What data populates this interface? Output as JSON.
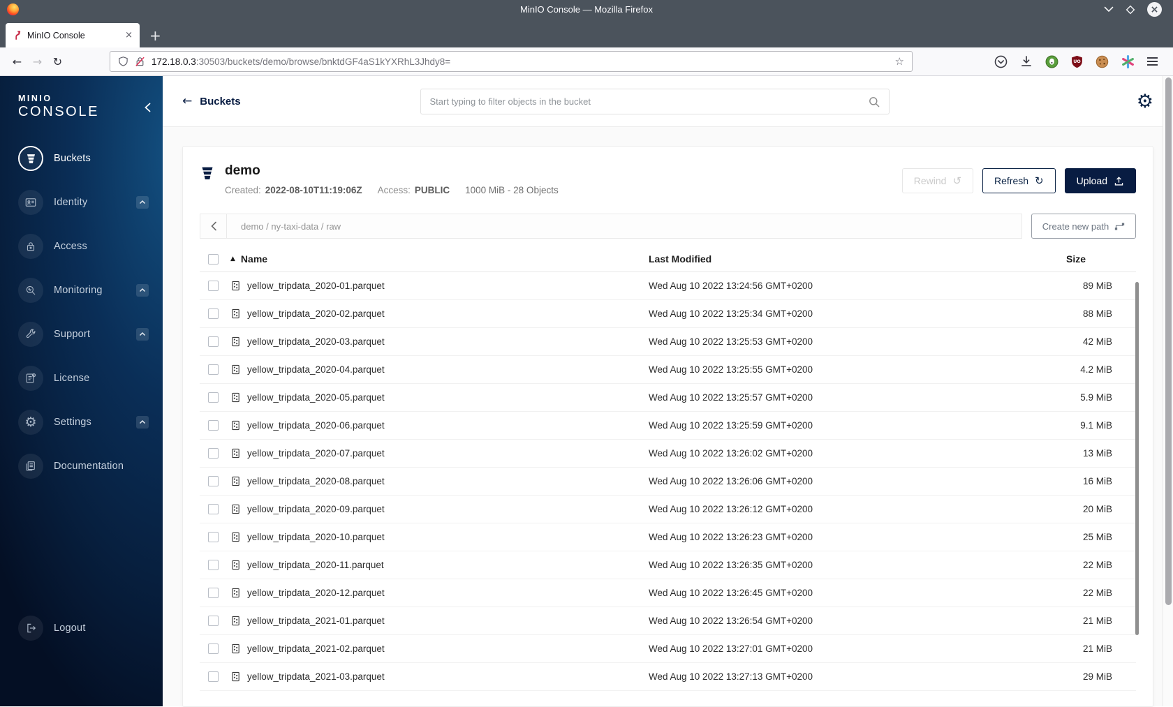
{
  "window": {
    "title": "MinIO Console — Mozilla Firefox"
  },
  "browser": {
    "tab_title": "MinIO Console",
    "url_host": "172.18.0.3",
    "url_path": ":30503/buckets/demo/browse/bnktdGF4aS1kYXRhL3Jhdy8=",
    "extension_icons": [
      "pocket-icon",
      "download-icon",
      "privacy-badger-icon",
      "ublock-origin-icon",
      "cookie-icon",
      "asterisk-extension-icon",
      "menu-icon"
    ]
  },
  "glyphs": {
    "back_arrow": "←",
    "forward_arrow": "→",
    "reload": "↻",
    "refresh": "↻",
    "rewind": "↺",
    "gear": "⚙",
    "bookmark_star": "☆",
    "sort_asc": "▲",
    "new_tab": "+",
    "close": "×"
  },
  "sidebar": {
    "logo_line1": "MINIO",
    "logo_line2": "CONSOLE",
    "items": [
      {
        "label": "Buckets",
        "icon": "buckets-icon",
        "selected": true,
        "expandable": false
      },
      {
        "label": "Identity",
        "icon": "identity-icon",
        "selected": false,
        "expandable": true
      },
      {
        "label": "Access",
        "icon": "access-icon",
        "selected": false,
        "expandable": false
      },
      {
        "label": "Monitoring",
        "icon": "monitoring-icon",
        "selected": false,
        "expandable": true
      },
      {
        "label": "Support",
        "icon": "support-icon",
        "selected": false,
        "expandable": true
      },
      {
        "label": "License",
        "icon": "license-icon",
        "selected": false,
        "expandable": false
      },
      {
        "label": "Settings",
        "icon": "settings-icon",
        "selected": false,
        "expandable": true
      },
      {
        "label": "Documentation",
        "icon": "documentation-icon",
        "selected": false,
        "expandable": false
      }
    ],
    "logout": {
      "label": "Logout",
      "icon": "logout-icon"
    }
  },
  "header": {
    "back_label": "Buckets",
    "search_placeholder": "Start typing to filter objects in the bucket"
  },
  "bucket": {
    "name": "demo",
    "created_label": "Created:",
    "created_value": "2022-08-10T11:19:06Z",
    "access_label": "Access:",
    "access_value": "PUBLIC",
    "summary": "1000 MiB - 28 Objects",
    "buttons": {
      "rewind": "Rewind",
      "refresh": "Refresh",
      "upload": "Upload"
    }
  },
  "pathbar": {
    "breadcrumb": "demo / ny-taxi-data / raw",
    "create_button": "Create new path"
  },
  "table": {
    "columns": {
      "name": "Name",
      "modified": "Last Modified",
      "size": "Size"
    },
    "rows": [
      {
        "name": "yellow_tripdata_2020-01.parquet",
        "modified": "Wed Aug 10 2022 13:24:56 GMT+0200",
        "size": "89 MiB"
      },
      {
        "name": "yellow_tripdata_2020-02.parquet",
        "modified": "Wed Aug 10 2022 13:25:34 GMT+0200",
        "size": "88 MiB"
      },
      {
        "name": "yellow_tripdata_2020-03.parquet",
        "modified": "Wed Aug 10 2022 13:25:53 GMT+0200",
        "size": "42 MiB"
      },
      {
        "name": "yellow_tripdata_2020-04.parquet",
        "modified": "Wed Aug 10 2022 13:25:55 GMT+0200",
        "size": "4.2 MiB"
      },
      {
        "name": "yellow_tripdata_2020-05.parquet",
        "modified": "Wed Aug 10 2022 13:25:57 GMT+0200",
        "size": "5.9 MiB"
      },
      {
        "name": "yellow_tripdata_2020-06.parquet",
        "modified": "Wed Aug 10 2022 13:25:59 GMT+0200",
        "size": "9.1 MiB"
      },
      {
        "name": "yellow_tripdata_2020-07.parquet",
        "modified": "Wed Aug 10 2022 13:26:02 GMT+0200",
        "size": "13 MiB"
      },
      {
        "name": "yellow_tripdata_2020-08.parquet",
        "modified": "Wed Aug 10 2022 13:26:06 GMT+0200",
        "size": "16 MiB"
      },
      {
        "name": "yellow_tripdata_2020-09.parquet",
        "modified": "Wed Aug 10 2022 13:26:12 GMT+0200",
        "size": "20 MiB"
      },
      {
        "name": "yellow_tripdata_2020-10.parquet",
        "modified": "Wed Aug 10 2022 13:26:23 GMT+0200",
        "size": "25 MiB"
      },
      {
        "name": "yellow_tripdata_2020-11.parquet",
        "modified": "Wed Aug 10 2022 13:26:35 GMT+0200",
        "size": "22 MiB"
      },
      {
        "name": "yellow_tripdata_2020-12.parquet",
        "modified": "Wed Aug 10 2022 13:26:45 GMT+0200",
        "size": "22 MiB"
      },
      {
        "name": "yellow_tripdata_2021-01.parquet",
        "modified": "Wed Aug 10 2022 13:26:54 GMT+0200",
        "size": "21 MiB"
      },
      {
        "name": "yellow_tripdata_2021-02.parquet",
        "modified": "Wed Aug 10 2022 13:27:01 GMT+0200",
        "size": "21 MiB"
      },
      {
        "name": "yellow_tripdata_2021-03.parquet",
        "modified": "Wed Aug 10 2022 13:27:13 GMT+0200",
        "size": "29 MiB"
      }
    ]
  },
  "colors": {
    "navy": "#081C42",
    "titlebar": "#4b535c",
    "sidebar_top": "#135081",
    "sidebar_bottom": "#040f24",
    "brand_red": "#c72c48"
  }
}
